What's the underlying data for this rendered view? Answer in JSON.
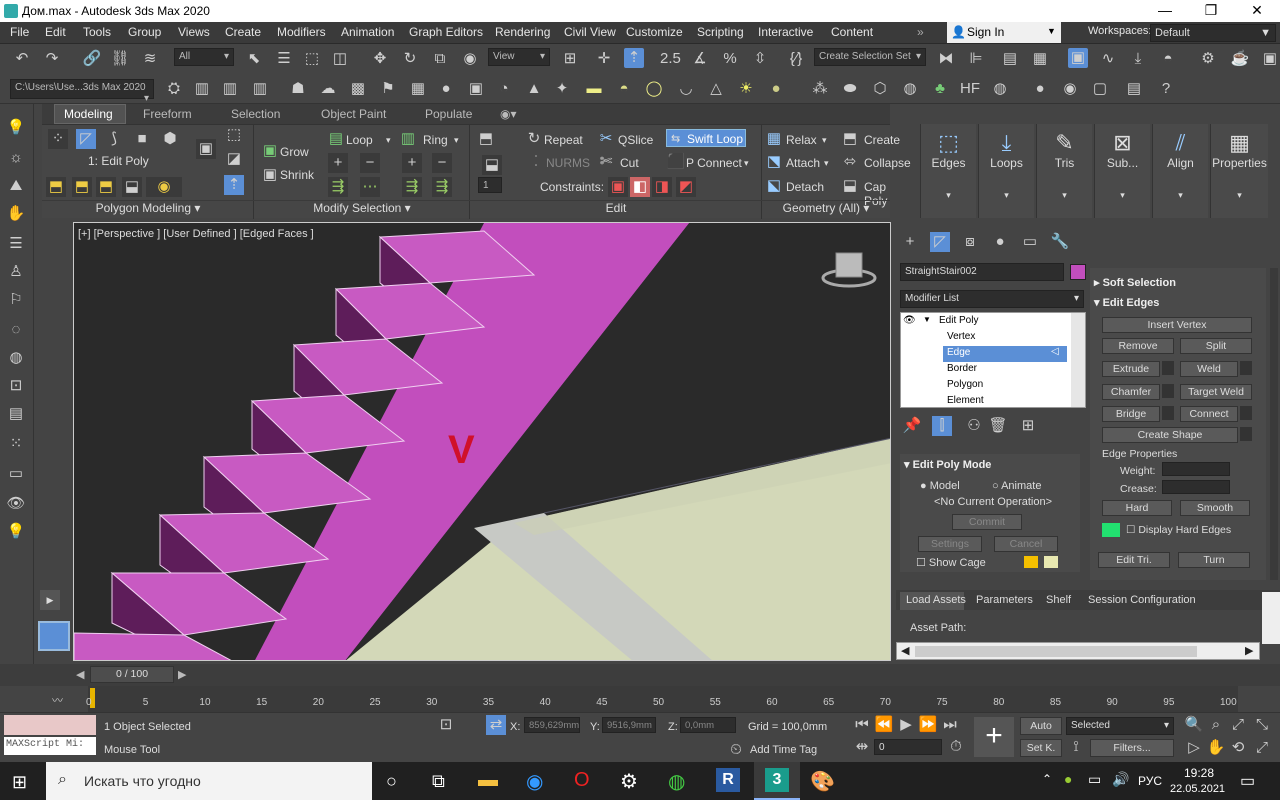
{
  "title": "Дом.max - Autodesk 3ds Max 2020",
  "menu": [
    "File",
    "Edit",
    "Tools",
    "Group",
    "Views",
    "Create",
    "Modifiers",
    "Animation",
    "Graph Editors",
    "Rendering",
    "Civil View",
    "Customize",
    "Scripting",
    "Interactive",
    "Content"
  ],
  "signin": "Sign In",
  "workspaces_label": "Workspaces:",
  "workspace": "Default",
  "toolbar": {
    "filter": "All",
    "view": "View",
    "selection_set": "Create Selection Set",
    "path": "C:\\Users\\Use...3ds Max 2020"
  },
  "ribbon_tabs": [
    "Modeling",
    "Freeform",
    "Selection",
    "Object Paint",
    "Populate"
  ],
  "ribbon": {
    "mode": "1: Edit Poly",
    "grow": "Grow",
    "shrink": "Shrink",
    "loop": "Loop",
    "ring": "Ring",
    "repeat": "Repeat",
    "qslice": "QSlice",
    "swift_loop": "Swift Loop",
    "nurms": "NURMS",
    "cut": "Cut",
    "pconnect": "P Connect",
    "constraints": "Constraints:",
    "spin": "1",
    "relax": "Relax",
    "create": "Create",
    "attach": "Attach",
    "collapse": "Collapse",
    "detach": "Detach",
    "cap_poly": "Cap Poly",
    "sections": [
      "Polygon Modeling",
      "Modify Selection",
      "Edit",
      "Geometry (All)"
    ],
    "big": [
      "Edges",
      "Loops",
      "Tris",
      "Sub...",
      "Align",
      "Properties"
    ]
  },
  "viewport": {
    "label": "[+] [Perspective ] [User Defined ] [Edged Faces ]"
  },
  "cmd": {
    "object": "StraightStair002",
    "modifier_list": "Modifier List",
    "stack": [
      "Edit Poly",
      "Vertex",
      "Edge",
      "Border",
      "Polygon",
      "Element"
    ],
    "selected": "Edge",
    "soft_selection": "Soft Selection",
    "edit_edges": "Edit Edges",
    "buttons": {
      "insert_vertex": "Insert Vertex",
      "remove": "Remove",
      "split": "Split",
      "extrude": "Extrude",
      "weld": "Weld",
      "chamfer": "Chamfer",
      "target_weld": "Target Weld",
      "bridge": "Bridge",
      "connect": "Connect",
      "create_shape": "Create Shape",
      "hard": "Hard",
      "smooth": "Smooth",
      "edit_tri": "Edit Tri.",
      "turn": "Turn"
    },
    "edge_properties": "Edge Properties",
    "weight": "Weight:",
    "crease": "Crease:",
    "display_hard_edges": "Display Hard Edges",
    "edit_poly_mode": "Edit Poly Mode",
    "model": "Model",
    "animate": "Animate",
    "no_op": "<No Current Operation>",
    "commit": "Commit",
    "settings": "Settings",
    "cancel": "Cancel",
    "show_cage": "Show Cage"
  },
  "asset_tabs": [
    "Load Assets",
    "Parameters",
    "Shelf",
    "Session Configuration"
  ],
  "asset_path": "Asset Path:",
  "time": {
    "range": "0 / 100",
    "ticks": [
      "0",
      "5",
      "10",
      "15",
      "20",
      "25",
      "30",
      "35",
      "40",
      "45",
      "50",
      "55",
      "60",
      "65",
      "70",
      "75",
      "80",
      "85",
      "90",
      "95",
      "100"
    ]
  },
  "status": {
    "selected": "1 Object Selected",
    "mouse": "Mouse Tool",
    "maxscript": "MAXScript Mi:",
    "x_label": "X:",
    "x": "859,629mm",
    "y_label": "Y:",
    "y": "9516,9mm",
    "z_label": "Z:",
    "z": "0,0mm",
    "grid": "Grid = 100,0mm",
    "add_time_tag": "Add Time Tag",
    "frame": "0",
    "auto": "Auto",
    "setk": "Set K.",
    "selected_combo": "Selected",
    "filters": "Filters..."
  },
  "taskbar": {
    "search": "Искать что угодно",
    "lang": "РУС",
    "time": "19:28",
    "date": "22.05.2021"
  },
  "colors": {
    "stair": "#c050b8",
    "floor": "#d3d8b8",
    "accent": "#5b8fd6"
  }
}
